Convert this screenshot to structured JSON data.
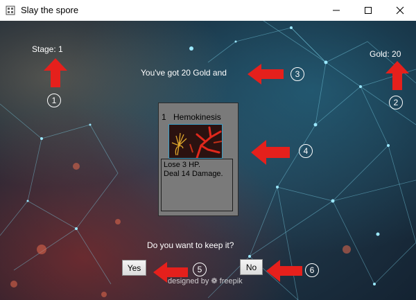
{
  "window": {
    "title": "Slay the spore",
    "controls": {
      "minimize": "minimize-icon",
      "maximize": "maximize-icon",
      "close": "close-icon"
    }
  },
  "hud": {
    "stage": "Stage: 1",
    "gold": "Gold: 20"
  },
  "reward": {
    "message": "You've got 20 Gold and",
    "prompt": "Do  you want to keep it?"
  },
  "card": {
    "cost": "1",
    "name": "Hemokinesis",
    "description": [
      "Lose 3 HP.",
      "Deal 14 Damage."
    ]
  },
  "buttons": {
    "yes": "Yes",
    "no": "No"
  },
  "credit": "designed by ❁ freepik",
  "annotations": {
    "markers": [
      "1",
      "2",
      "3",
      "4",
      "5",
      "6"
    ],
    "arrow_color": "#e5201c"
  },
  "colors": {
    "card_bg": "#7a7a7a",
    "text": "#ffffff",
    "network_lines": "#7fd6ee"
  }
}
